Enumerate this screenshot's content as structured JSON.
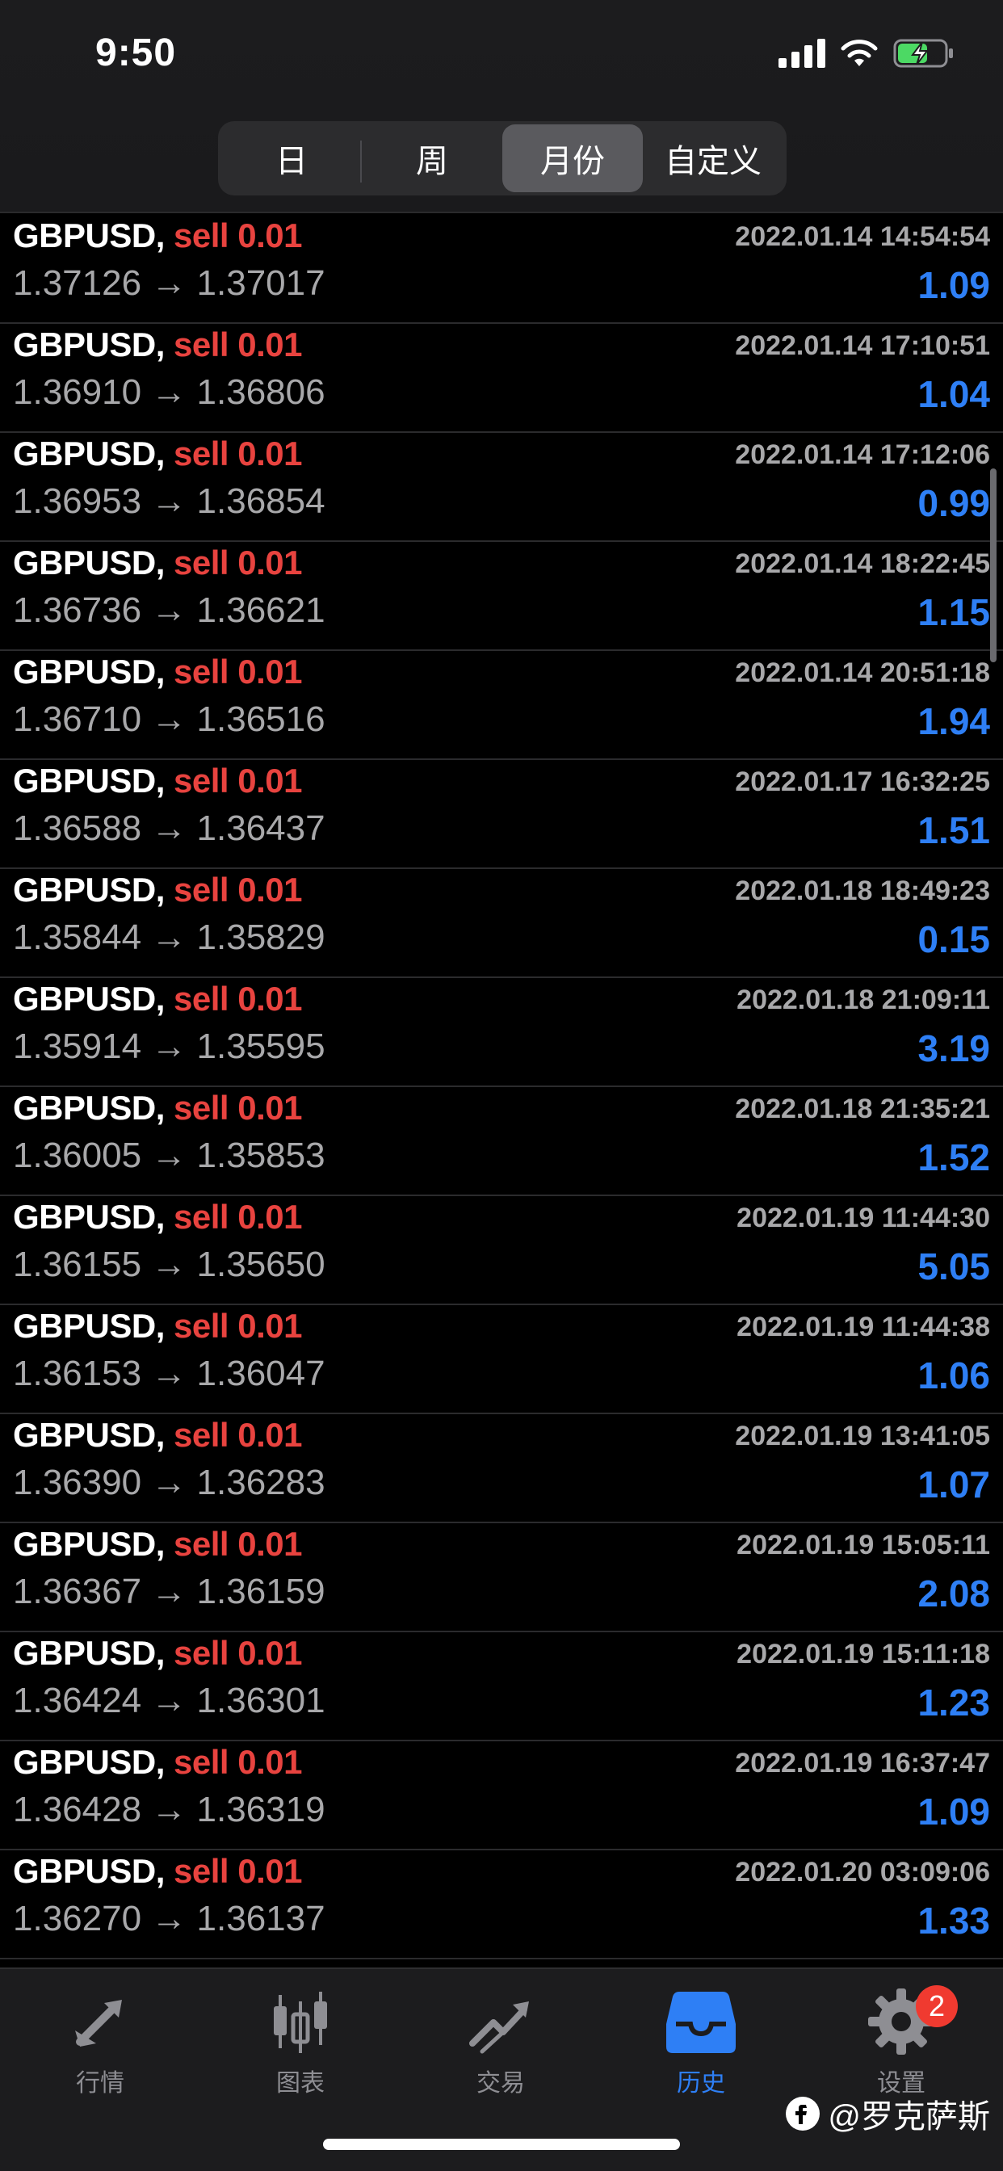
{
  "status": {
    "time": "9:50"
  },
  "segments": [
    {
      "label": "日",
      "active": false
    },
    {
      "label": "周",
      "active": false
    },
    {
      "label": "月份",
      "active": true
    },
    {
      "label": "自定义",
      "active": false
    }
  ],
  "trades": [
    {
      "symbol": "GBPUSD,",
      "side": "sell 0.01",
      "datetime": "2022.01.14 14:54:54",
      "open": "1.37126",
      "close": "1.37017",
      "profit": "1.09"
    },
    {
      "symbol": "GBPUSD,",
      "side": "sell 0.01",
      "datetime": "2022.01.14 17:10:51",
      "open": "1.36910",
      "close": "1.36806",
      "profit": "1.04"
    },
    {
      "symbol": "GBPUSD,",
      "side": "sell 0.01",
      "datetime": "2022.01.14 17:12:06",
      "open": "1.36953",
      "close": "1.36854",
      "profit": "0.99"
    },
    {
      "symbol": "GBPUSD,",
      "side": "sell 0.01",
      "datetime": "2022.01.14 18:22:45",
      "open": "1.36736",
      "close": "1.36621",
      "profit": "1.15"
    },
    {
      "symbol": "GBPUSD,",
      "side": "sell 0.01",
      "datetime": "2022.01.14 20:51:18",
      "open": "1.36710",
      "close": "1.36516",
      "profit": "1.94"
    },
    {
      "symbol": "GBPUSD,",
      "side": "sell 0.01",
      "datetime": "2022.01.17 16:32:25",
      "open": "1.36588",
      "close": "1.36437",
      "profit": "1.51"
    },
    {
      "symbol": "GBPUSD,",
      "side": "sell 0.01",
      "datetime": "2022.01.18 18:49:23",
      "open": "1.35844",
      "close": "1.35829",
      "profit": "0.15"
    },
    {
      "symbol": "GBPUSD,",
      "side": "sell 0.01",
      "datetime": "2022.01.18 21:09:11",
      "open": "1.35914",
      "close": "1.35595",
      "profit": "3.19"
    },
    {
      "symbol": "GBPUSD,",
      "side": "sell 0.01",
      "datetime": "2022.01.18 21:35:21",
      "open": "1.36005",
      "close": "1.35853",
      "profit": "1.52"
    },
    {
      "symbol": "GBPUSD,",
      "side": "sell 0.01",
      "datetime": "2022.01.19 11:44:30",
      "open": "1.36155",
      "close": "1.35650",
      "profit": "5.05"
    },
    {
      "symbol": "GBPUSD,",
      "side": "sell 0.01",
      "datetime": "2022.01.19 11:44:38",
      "open": "1.36153",
      "close": "1.36047",
      "profit": "1.06"
    },
    {
      "symbol": "GBPUSD,",
      "side": "sell 0.01",
      "datetime": "2022.01.19 13:41:05",
      "open": "1.36390",
      "close": "1.36283",
      "profit": "1.07"
    },
    {
      "symbol": "GBPUSD,",
      "side": "sell 0.01",
      "datetime": "2022.01.19 15:05:11",
      "open": "1.36367",
      "close": "1.36159",
      "profit": "2.08"
    },
    {
      "symbol": "GBPUSD,",
      "side": "sell 0.01",
      "datetime": "2022.01.19 15:11:18",
      "open": "1.36424",
      "close": "1.36301",
      "profit": "1.23"
    },
    {
      "symbol": "GBPUSD,",
      "side": "sell 0.01",
      "datetime": "2022.01.19 16:37:47",
      "open": "1.36428",
      "close": "1.36319",
      "profit": "1.09"
    },
    {
      "symbol": "GBPUSD,",
      "side": "sell 0.01",
      "datetime": "2022.01.20 03:09:06",
      "open": "1.36270",
      "close": "1.36137",
      "profit": "1.33"
    }
  ],
  "arrow": "→",
  "tabs": [
    {
      "label": "行情",
      "icon": "quotes-arrows-icon",
      "active": false
    },
    {
      "label": "图表",
      "icon": "candlestick-chart-icon",
      "active": false
    },
    {
      "label": "交易",
      "icon": "trade-trend-icon",
      "active": false
    },
    {
      "label": "历史",
      "icon": "history-inbox-icon",
      "active": true
    },
    {
      "label": "设置",
      "icon": "settings-gear-icon",
      "active": false,
      "badge": "2"
    }
  ],
  "watermark": "@罗克萨斯",
  "colors": {
    "sell": "#e8433f",
    "profit": "#2e7ff5",
    "tab_active": "#2e7ff5",
    "badge": "#f03a30"
  }
}
